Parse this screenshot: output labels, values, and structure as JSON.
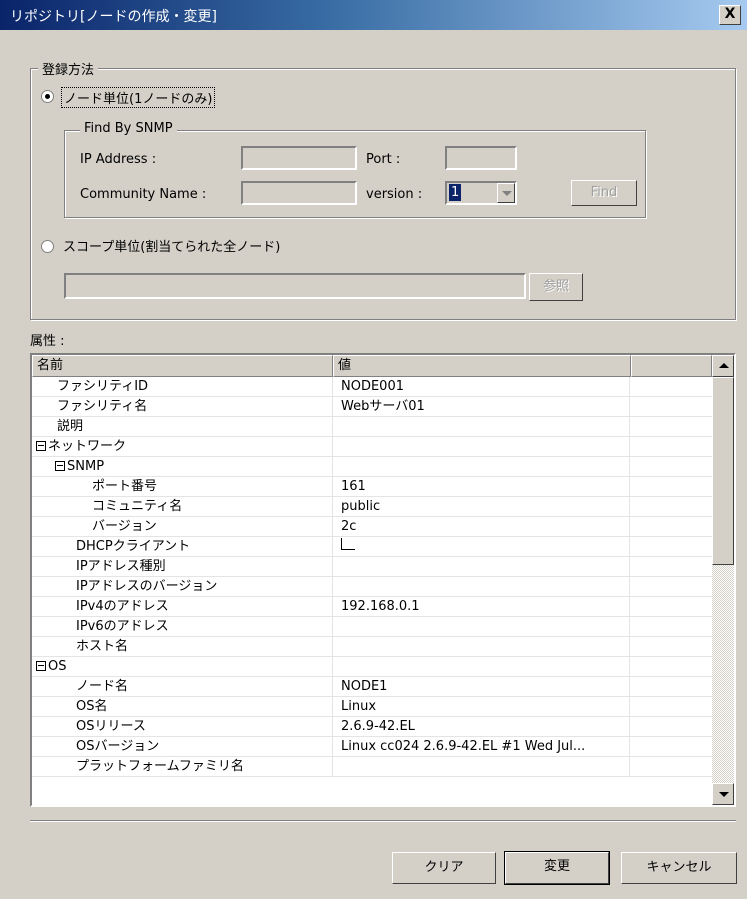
{
  "window": {
    "title": "リポジトリ[ノードの作成・変更]",
    "close_label": "X"
  },
  "registration": {
    "legend": "登録方法",
    "node_option": "ノード単位(1ノードのみ)",
    "scope_option": "スコープ単位(割当てられた全ノード)",
    "selected": "node",
    "browse_label": "参照",
    "scope_value": ""
  },
  "snmp_find": {
    "legend": "Find By SNMP",
    "ip_label": "IP Address :",
    "ip_value": "",
    "port_label": "Port :",
    "port_value": "",
    "community_label": "Community Name :",
    "community_value": "",
    "version_label": "version :",
    "version_value": "1",
    "find_label": "Find"
  },
  "attributes": {
    "label": "属性 :",
    "columns": [
      "名前",
      "値",
      ""
    ],
    "rows": [
      {
        "name": "ファシリティID",
        "value": "NODE001"
      },
      {
        "name": "ファシリティ名",
        "value": "Webサーバ01"
      },
      {
        "name": "説明",
        "value": ""
      },
      {
        "name": "ネットワーク",
        "value": ""
      },
      {
        "name": "SNMP",
        "value": ""
      },
      {
        "name": "ポート番号",
        "value": "161"
      },
      {
        "name": "コミュニティ名",
        "value": "public"
      },
      {
        "name": "バージョン",
        "value": "2c"
      },
      {
        "name": "DHCPクライアント",
        "value": ""
      },
      {
        "name": "IPアドレス種別",
        "value": ""
      },
      {
        "name": "IPアドレスのバージョン",
        "value": ""
      },
      {
        "name": "IPv4のアドレス",
        "value": "192.168.0.1"
      },
      {
        "name": "IPv6のアドレス",
        "value": ""
      },
      {
        "name": "ホスト名",
        "value": ""
      },
      {
        "name": "OS",
        "value": ""
      },
      {
        "name": "ノード名",
        "value": "NODE1"
      },
      {
        "name": "OS名",
        "value": "Linux"
      },
      {
        "name": "OSリリース",
        "value": "2.6.9-42.EL"
      },
      {
        "name": "OSバージョン",
        "value": "Linux cc024 2.6.9-42.EL #1 Wed Jul..."
      },
      {
        "name": "プラットフォームファミリ名",
        "value": ""
      }
    ]
  },
  "buttons": {
    "clear": "クリア",
    "change": "変更",
    "cancel": "キャンセル"
  }
}
